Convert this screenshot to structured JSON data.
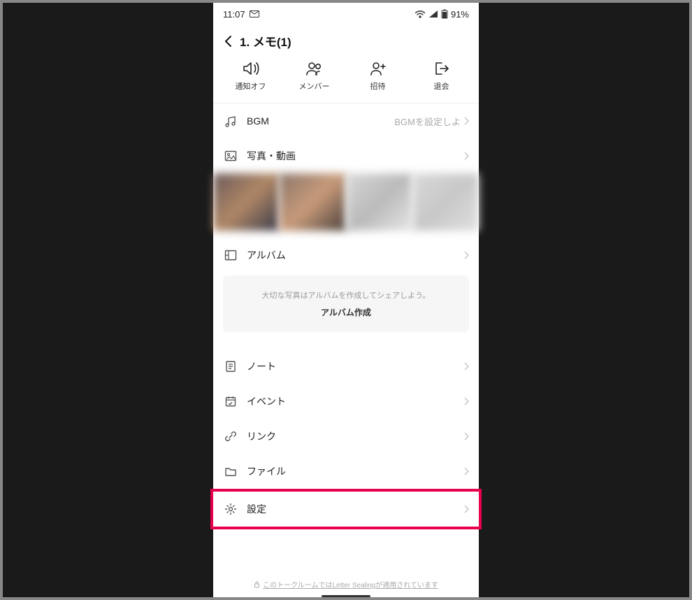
{
  "status": {
    "time": "11:07",
    "battery": "91%"
  },
  "header": {
    "title": "1. メモ(1)"
  },
  "actions": {
    "notify_off": "通知オフ",
    "members": "メンバー",
    "invite": "招待",
    "leave": "退会"
  },
  "rows": {
    "bgm_label": "BGM",
    "bgm_value": "BGMを設定しよ",
    "photos_label": "写真・動画",
    "album_label": "アルバム",
    "note_label": "ノート",
    "event_label": "イベント",
    "link_label": "リンク",
    "file_label": "ファイル",
    "settings_label": "設定"
  },
  "album_box": {
    "hint": "大切な写真はアルバムを作成してシェアしよう。",
    "cta": "アルバム作成"
  },
  "footer": {
    "text": "このトークルームではLetter Sealingが適用されています"
  }
}
